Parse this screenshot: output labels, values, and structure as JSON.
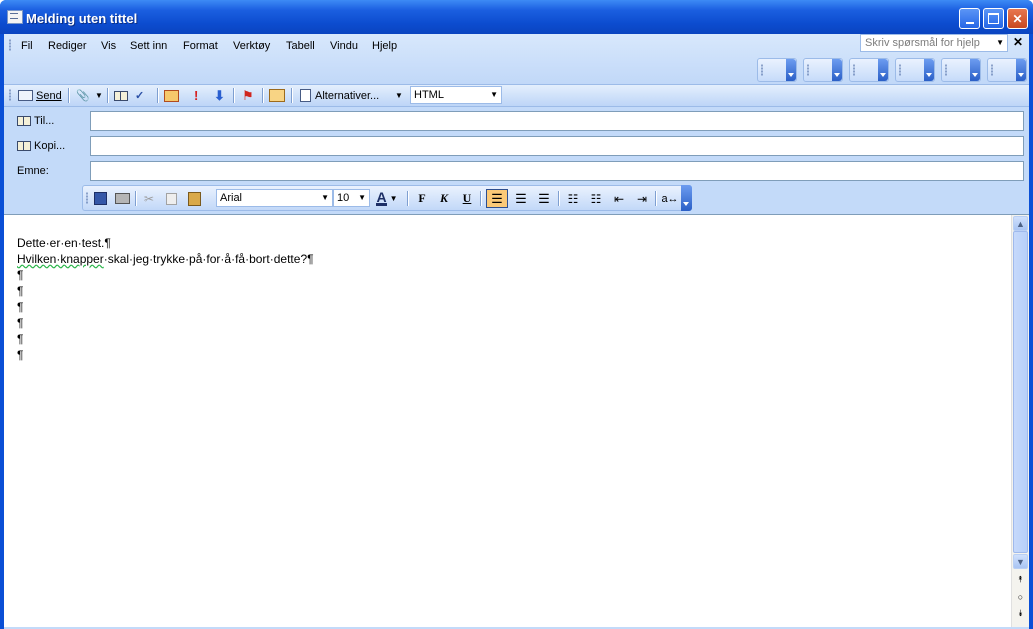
{
  "window": {
    "title": "Melding uten tittel",
    "minimize_icon": "minimize-icon",
    "maximize_icon": "maximize-icon",
    "close_icon": "close-icon"
  },
  "menu": {
    "items": [
      "Fil",
      "Rediger",
      "Vis",
      "Sett inn",
      "Format",
      "Verktøy",
      "Tabell",
      "Vindu",
      "Hjelp"
    ],
    "help_placeholder": "Skriv spørsmål for hjelp",
    "close_glyph": "✕"
  },
  "toolbar": {
    "send_label": "Send",
    "options_label": "Alternativer...",
    "format_value": "HTML"
  },
  "fields": {
    "to_label": "Til...",
    "cc_label": "Kopi...",
    "subject_label": "Emne:",
    "to_value": "",
    "cc_value": "",
    "subject_value": ""
  },
  "formatting": {
    "font": "Arial",
    "size": "10",
    "bold": "F",
    "italic": "K",
    "underline": "U"
  },
  "body": {
    "lines": [
      "Dette·er·en·test.¶",
      "Hvilken·knapper·skal·jeg·trykke·på·for·å·få·bort·dette?¶",
      "¶",
      "¶",
      "¶",
      "¶",
      "¶",
      "¶"
    ]
  },
  "colors": {
    "title_bar": "#0a4fd6",
    "toolbar_bg": "#c3daf9",
    "active_align": "#fbc977"
  }
}
